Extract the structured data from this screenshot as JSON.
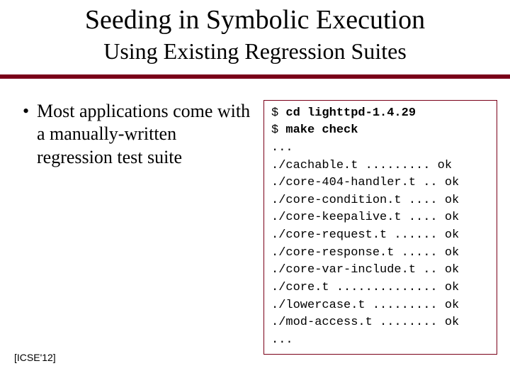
{
  "title": "Seeding in Symbolic Execution",
  "subtitle": "Using Existing Regression Suites",
  "left": {
    "bullet1": "Most applications come\nwith a manually-written\nregression test suite"
  },
  "terminal": {
    "prompt": "$",
    "cmd1": "cd lighttpd-1.4.29",
    "cmd2": "make check",
    "lines": [
      "...",
      "./cachable.t ......... ok",
      "./core-404-handler.t .. ok",
      "./core-condition.t .... ok",
      "./core-keepalive.t .... ok",
      "./core-request.t ...... ok",
      "./core-response.t ..... ok",
      "./core-var-include.t .. ok",
      "./core.t .............. ok",
      "./lowercase.t ......... ok",
      "./mod-access.t ........ ok",
      "..."
    ]
  },
  "citation": "[ICSE'12]"
}
